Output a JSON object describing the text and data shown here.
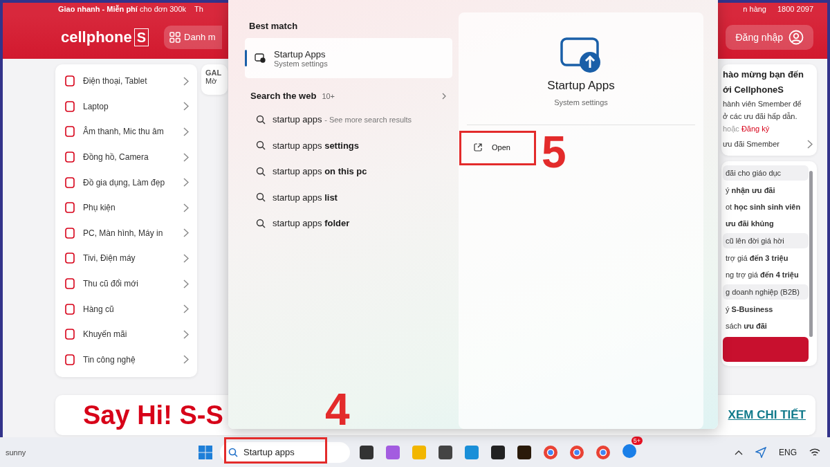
{
  "promo_bar": {
    "left_text": "**Giao nhanh - Miễn phí** cho đơn 300k",
    "middle_text": "Th",
    "right_text": "n hàng",
    "hotline": "1800 2097"
  },
  "header": {
    "logo_text": "cellphone",
    "logo_mark": "S",
    "category_button": "Danh m",
    "login_button": "Đăng nhập"
  },
  "sidebar": {
    "items": [
      {
        "label": "Điện thoại, Tablet"
      },
      {
        "label": "Laptop"
      },
      {
        "label": "Âm thanh, Mic thu âm"
      },
      {
        "label": "Đồng hồ, Camera"
      },
      {
        "label": "Đồ gia dụng, Làm đẹp"
      },
      {
        "label": "Phụ kiện"
      },
      {
        "label": "PC, Màn hình, Máy in"
      },
      {
        "label": "Tivi, Điện máy"
      },
      {
        "label": "Thu cũ đổi mới"
      },
      {
        "label": "Hàng cũ"
      },
      {
        "label": "Khuyến mãi"
      },
      {
        "label": "Tin công nghệ"
      }
    ]
  },
  "middle_card": {
    "title": "GAL",
    "subtitle": "Mờ"
  },
  "welcome_card": {
    "title_lines": [
      "hào mừng bạn đến",
      "ới CellphoneS"
    ],
    "text_lines": [
      "hành viên Smember để",
      "ở các ưu đãi hấp dẫn."
    ],
    "register_prefix": "hoặc",
    "register_link": "Đăng ký",
    "member_link": "ưu đãi Smember"
  },
  "offers": [
    {
      "kind": "header",
      "text": "đãi cho giáo dục"
    },
    {
      "kind": "item",
      "text": "ý **nhận ưu đãi**"
    },
    {
      "kind": "item",
      "text": "ot **học sinh sinh viên**"
    },
    {
      "kind": "item",
      "text": "**ưu đãi khủng**"
    },
    {
      "kind": "header",
      "text": "cũ lên đời giá hời"
    },
    {
      "kind": "item",
      "text": "trợ giá **đến 3 triệu**"
    },
    {
      "kind": "item",
      "text": "ng trợ giá **đến 4 triệu**"
    },
    {
      "kind": "header",
      "text": "g doanh nghiệp (B2B)"
    },
    {
      "kind": "item",
      "text": "ý **S-Business**"
    },
    {
      "kind": "item",
      "text": "sách **ưu đãi**"
    }
  ],
  "bottom_banner": {
    "title": "Say Hi! S-S",
    "link": "XEM CHI TIẾT"
  },
  "search": {
    "best_match_heading": "Best match",
    "best_match": {
      "title": "Startup Apps",
      "subtitle": "System settings",
      "selected": true
    },
    "web_heading": "Search the web",
    "web_count": "10+",
    "suggestions": [
      {
        "text": "startup apps",
        "hint": "- See more search results"
      },
      {
        "text": "startup apps **settings**"
      },
      {
        "text": "startup apps **on this pc**"
      },
      {
        "text": "startup apps **list**"
      },
      {
        "text": "startup apps **folder**"
      }
    ],
    "detail": {
      "title": "Startup Apps",
      "subtitle": "System settings",
      "action": "Open"
    }
  },
  "annotations": [
    {
      "label": "5"
    },
    {
      "label": "4"
    }
  ],
  "taskbar": {
    "weather": "sunny",
    "search_value": "Startup apps",
    "badge": "5+",
    "language": "ENG"
  }
}
